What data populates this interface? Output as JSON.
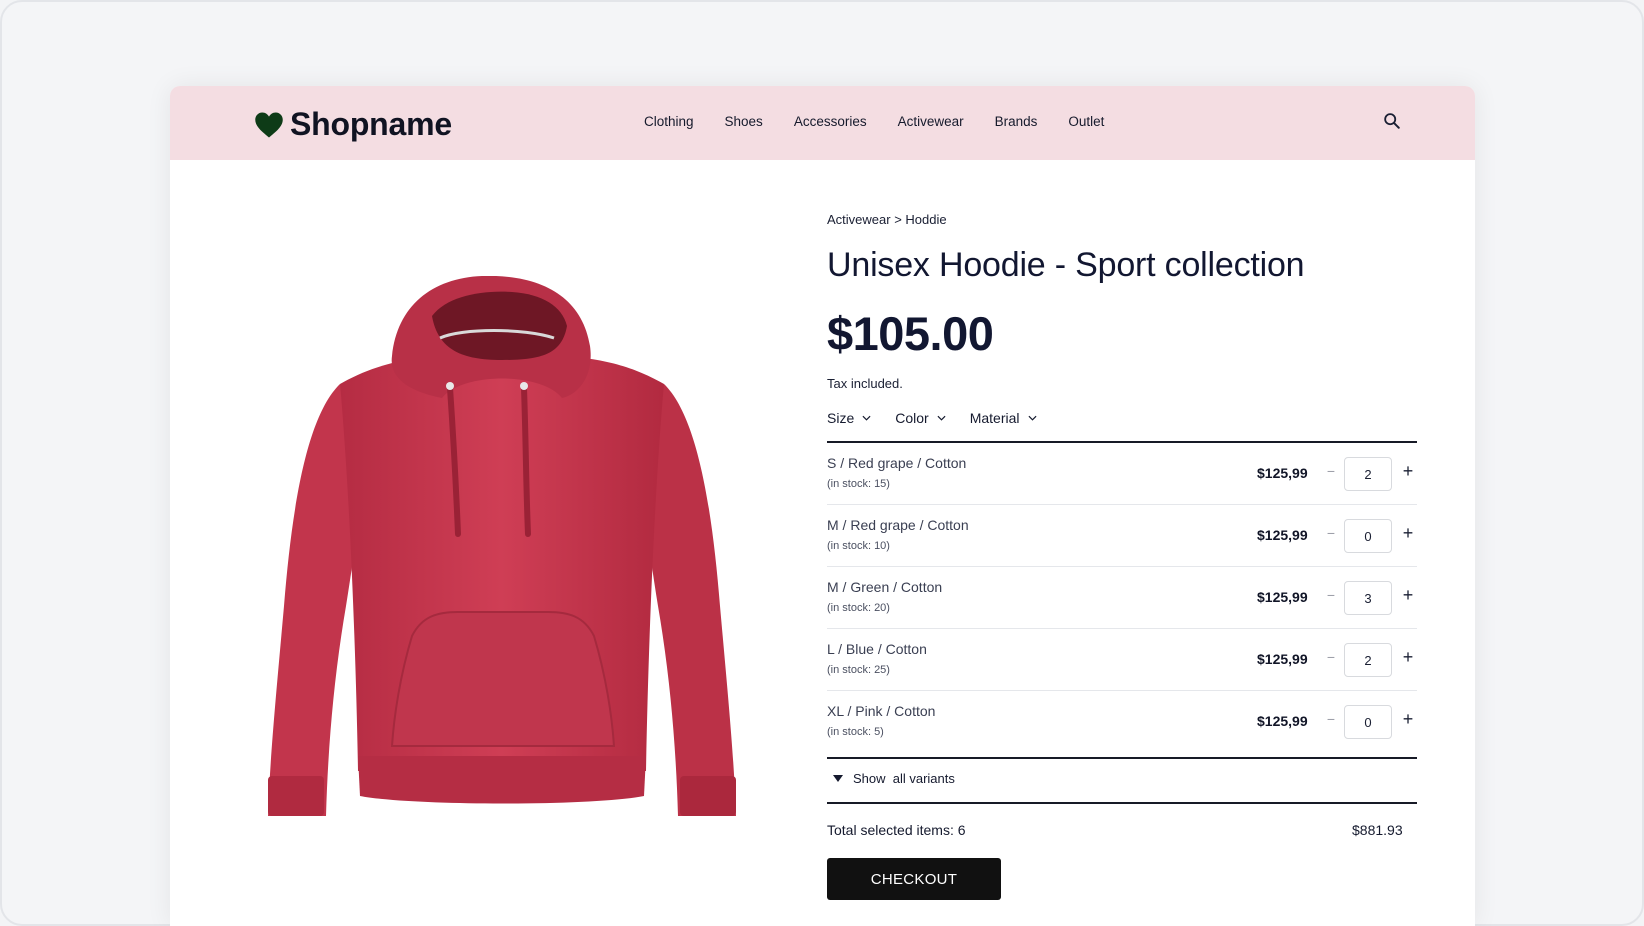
{
  "brand": {
    "name": "Shopname",
    "logo_icon": "heart-icon",
    "logo_color": "#0e3b17"
  },
  "header": {
    "background": "#f4dde2"
  },
  "nav": {
    "items": [
      "Clothing",
      "Shoes",
      "Accessories",
      "Activewear",
      "Brands",
      "Outlet"
    ]
  },
  "search": {
    "icon": "search-icon"
  },
  "product": {
    "image": {
      "subject": "red hoodie",
      "color": "#c83a50"
    },
    "breadcrumb": "Activewear > Hoddie",
    "title": "Unisex Hoodie - Sport collection",
    "price": "$105.00",
    "tax_note": "Tax included."
  },
  "filters": [
    {
      "label": "Size",
      "icon": "chevron-down-icon"
    },
    {
      "label": "Color",
      "icon": "chevron-down-icon"
    },
    {
      "label": "Material",
      "icon": "chevron-down-icon"
    }
  ],
  "variants": [
    {
      "name": "S / Red grape / Cotton",
      "stock": "(in stock: 15)",
      "price": "$125,99",
      "qty": "2"
    },
    {
      "name": "M / Red grape / Cotton",
      "stock": "(in stock: 10)",
      "price": "$125,99",
      "qty": "0"
    },
    {
      "name": "M / Green / Cotton",
      "stock": "(in stock: 20)",
      "price": "$125,99",
      "qty": "3"
    },
    {
      "name": "L / Blue / Cotton",
      "stock": "(in stock: 25)",
      "price": "$125,99",
      "qty": "2"
    },
    {
      "name": "XL / Pink / Cotton",
      "stock": "(in stock: 5)",
      "price": "$125,99",
      "qty": "0"
    }
  ],
  "stepper": {
    "minus": "−",
    "plus": "+"
  },
  "show_all": {
    "label": "Show  all variants",
    "icon": "triangle-down-icon"
  },
  "total": {
    "label": "Total selected items: 6",
    "value": "$881.93"
  },
  "checkout": {
    "label": "CHECKOUT",
    "background": "#111111"
  }
}
